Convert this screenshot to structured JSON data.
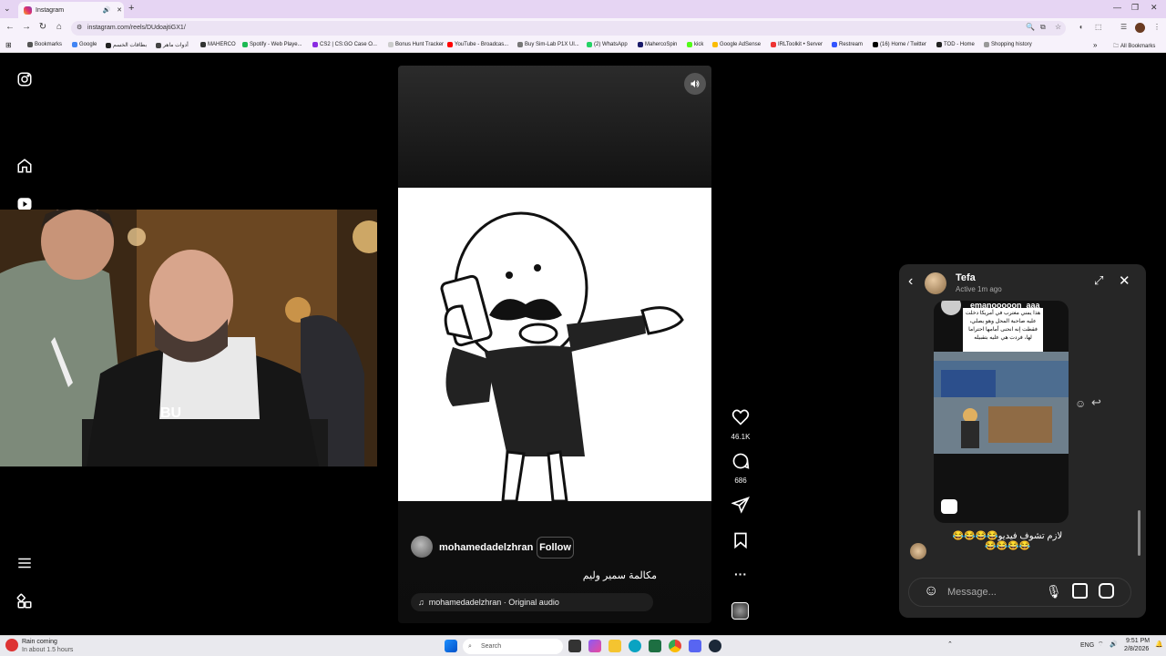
{
  "browser": {
    "tab_title": "Instagram",
    "url": "instagram.com/reels/DUdoajtiGX1/",
    "bookmarks": [
      {
        "label": "Bookmarks",
        "color": "#555555"
      },
      {
        "label": "Google",
        "color": "#4285f4"
      },
      {
        "label": "بطاقات الخسم",
        "color": "#222222"
      },
      {
        "label": "أدوات ماهر",
        "color": "#444444"
      },
      {
        "label": "MAHERCO",
        "color": "#333333"
      },
      {
        "label": "Spotify - Web Playe...",
        "color": "#1db954"
      },
      {
        "label": "CS2 | CS:GO Case O...",
        "color": "#8a2be2"
      },
      {
        "label": "Bonus Hunt Tracker",
        "color": "#cccccc"
      },
      {
        "label": "YouTube - Broadcas...",
        "color": "#ff0000"
      },
      {
        "label": "Buy Sim-Lab P1X Ul...",
        "color": "#777777"
      },
      {
        "label": "(2) WhatsApp",
        "color": "#25d366"
      },
      {
        "label": "MahercoSpin",
        "color": "#1a1a6a"
      },
      {
        "label": "kick",
        "color": "#53fc18"
      },
      {
        "label": "Google AdSense",
        "color": "#fbbc04"
      },
      {
        "label": "IRLToolkit • Server",
        "color": "#e33"
      },
      {
        "label": "Restream",
        "color": "#3355ff"
      },
      {
        "label": "(16) Home / Twitter",
        "color": "#000000"
      },
      {
        "label": "TOD - Home",
        "color": "#222222"
      },
      {
        "label": "Shopping history",
        "color": "#999999"
      }
    ],
    "all_bookmarks": "All Bookmarks"
  },
  "reel": {
    "author": "mohamedadelzhran",
    "follow_label": "Follow",
    "caption": "مكالمة سمير وليم",
    "audio": "mohamedadelzhran · Original audio",
    "likes": "46.1K",
    "comments": "686"
  },
  "chat": {
    "name": "Tefa",
    "status": "Active 1m ago",
    "shared_user": "emanooooon_aaa",
    "shared_text": "هذا يمني مغترب في أمريكا دخلت عليه صاحبة المحل وهو يصلي، فقطت إنه انحنى أمامها احتراما لها، فردت هي عليه بتقبيله",
    "message": "لازم تشوف فيديو😂😂😂😂 😂😂😂😂",
    "composer_placeholder": "Message..."
  },
  "taskbar": {
    "weather_title": "Rain coming",
    "weather_sub": "In about 1.5 hours",
    "search_placeholder": "Search",
    "lang": "ENG",
    "time": "9:51 PM",
    "date": "2/8/2026"
  }
}
